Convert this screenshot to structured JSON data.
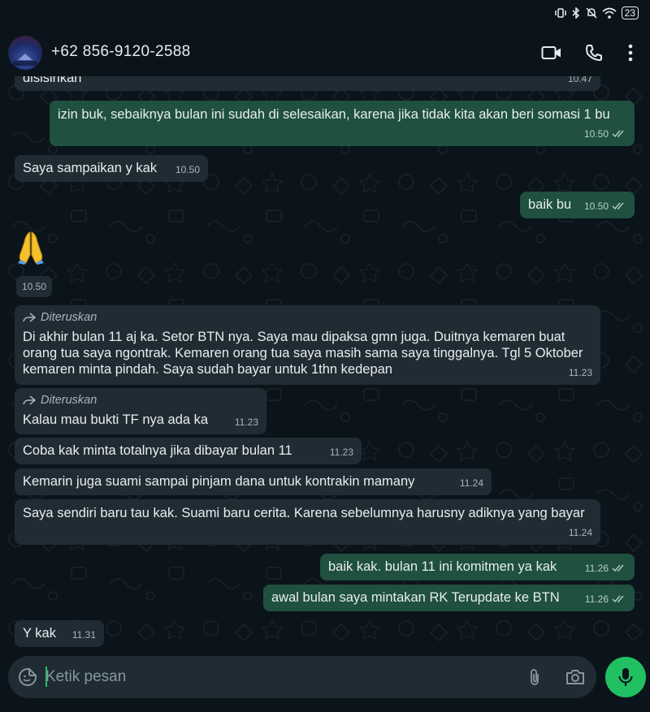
{
  "status_bar": {
    "battery": "23"
  },
  "header": {
    "contact_name": "+62 856-9120-2588"
  },
  "messages": [
    {
      "dir": "in",
      "text": "disisihkan",
      "time": "10.47"
    },
    {
      "dir": "out",
      "text": "izin buk, sebaiknya bulan ini sudah di selesaikan, karena jika tidak kita akan beri somasi 1 bu",
      "time": "10.50",
      "read": true
    },
    {
      "dir": "in",
      "text": "Saya sampaikan y kak",
      "time": "10.50"
    },
    {
      "dir": "out",
      "text": "baik bu",
      "time": "10.50",
      "read": true
    },
    {
      "dir": "in",
      "emoji": "🙏",
      "time": "10.50"
    },
    {
      "dir": "in",
      "forwarded": "Diteruskan",
      "text": "Di akhir bulan 11 aj ka. Setor BTN nya. Saya mau dipaksa gmn juga. Duitnya kemaren buat orang tua saya ngontrak. Kemaren orang tua saya masih sama saya tinggalnya. Tgl 5 Oktober kemaren minta pindah. Saya sudah bayar untuk 1thn kedepan",
      "time": "11.23"
    },
    {
      "dir": "in",
      "forwarded": "Diteruskan",
      "text": "Kalau mau bukti TF nya ada ka",
      "time": "11.23"
    },
    {
      "dir": "in",
      "text": "Coba kak minta totalnya jika dibayar bulan 11",
      "time": "11.23"
    },
    {
      "dir": "in",
      "text": "Kemarin juga suami sampai pinjam dana untuk kontrakin mamany",
      "time": "11.24"
    },
    {
      "dir": "in",
      "text": "Saya sendiri baru tau kak. Suami baru cerita. Karena sebelumnya harusny adiknya yang bayar",
      "time": "11.24"
    },
    {
      "dir": "out",
      "text": "baik kak. bulan 11 ini komitmen ya kak",
      "time": "11.26",
      "read": true
    },
    {
      "dir": "out",
      "text": "awal bulan saya mintakan RK Terupdate ke BTN",
      "time": "11.26",
      "read": true
    },
    {
      "dir": "in",
      "text": "Y kak",
      "time": "11.31"
    }
  ],
  "composer": {
    "placeholder": "Ketik pesan"
  },
  "icons": {
    "header": [
      "video-call-icon",
      "phone-icon",
      "more-options-icon"
    ],
    "composer": [
      "sticker-icon",
      "attach-icon",
      "camera-icon",
      "mic-icon"
    ],
    "status": [
      "vibrate-icon",
      "bluetooth-icon",
      "mute-icon",
      "wifi-icon",
      "battery-icon"
    ]
  },
  "colors": {
    "background": "#0b141a",
    "incoming_bubble": "#202c33",
    "outgoing_bubble": "#1f5040",
    "accent": "#21c063",
    "read_tick": "#b5cfc4"
  }
}
